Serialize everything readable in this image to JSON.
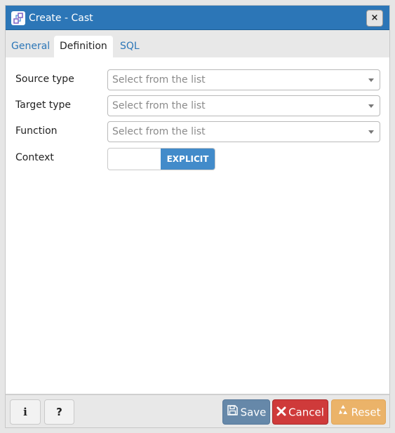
{
  "window": {
    "title": "Create - Cast",
    "close_label": "×"
  },
  "tabs": [
    {
      "label": "General",
      "active": false
    },
    {
      "label": "Definition",
      "active": true
    },
    {
      "label": "SQL",
      "active": false
    }
  ],
  "form": {
    "source_type": {
      "label": "Source type",
      "placeholder": "Select from the list"
    },
    "target_type": {
      "label": "Target type",
      "placeholder": "Select from the list"
    },
    "function": {
      "label": "Function",
      "placeholder": "Select from the list"
    },
    "context": {
      "label": "Context",
      "value": "EXPLICIT"
    }
  },
  "footer": {
    "info_label": "i",
    "help_label": "?",
    "save_label": "Save",
    "cancel_label": "Cancel",
    "reset_label": "Reset"
  },
  "colors": {
    "titlebar": "#2c76b7",
    "accent": "#428bca",
    "save": "#6688a9",
    "cancel": "#cf3a3a",
    "reset": "#ebb369"
  }
}
